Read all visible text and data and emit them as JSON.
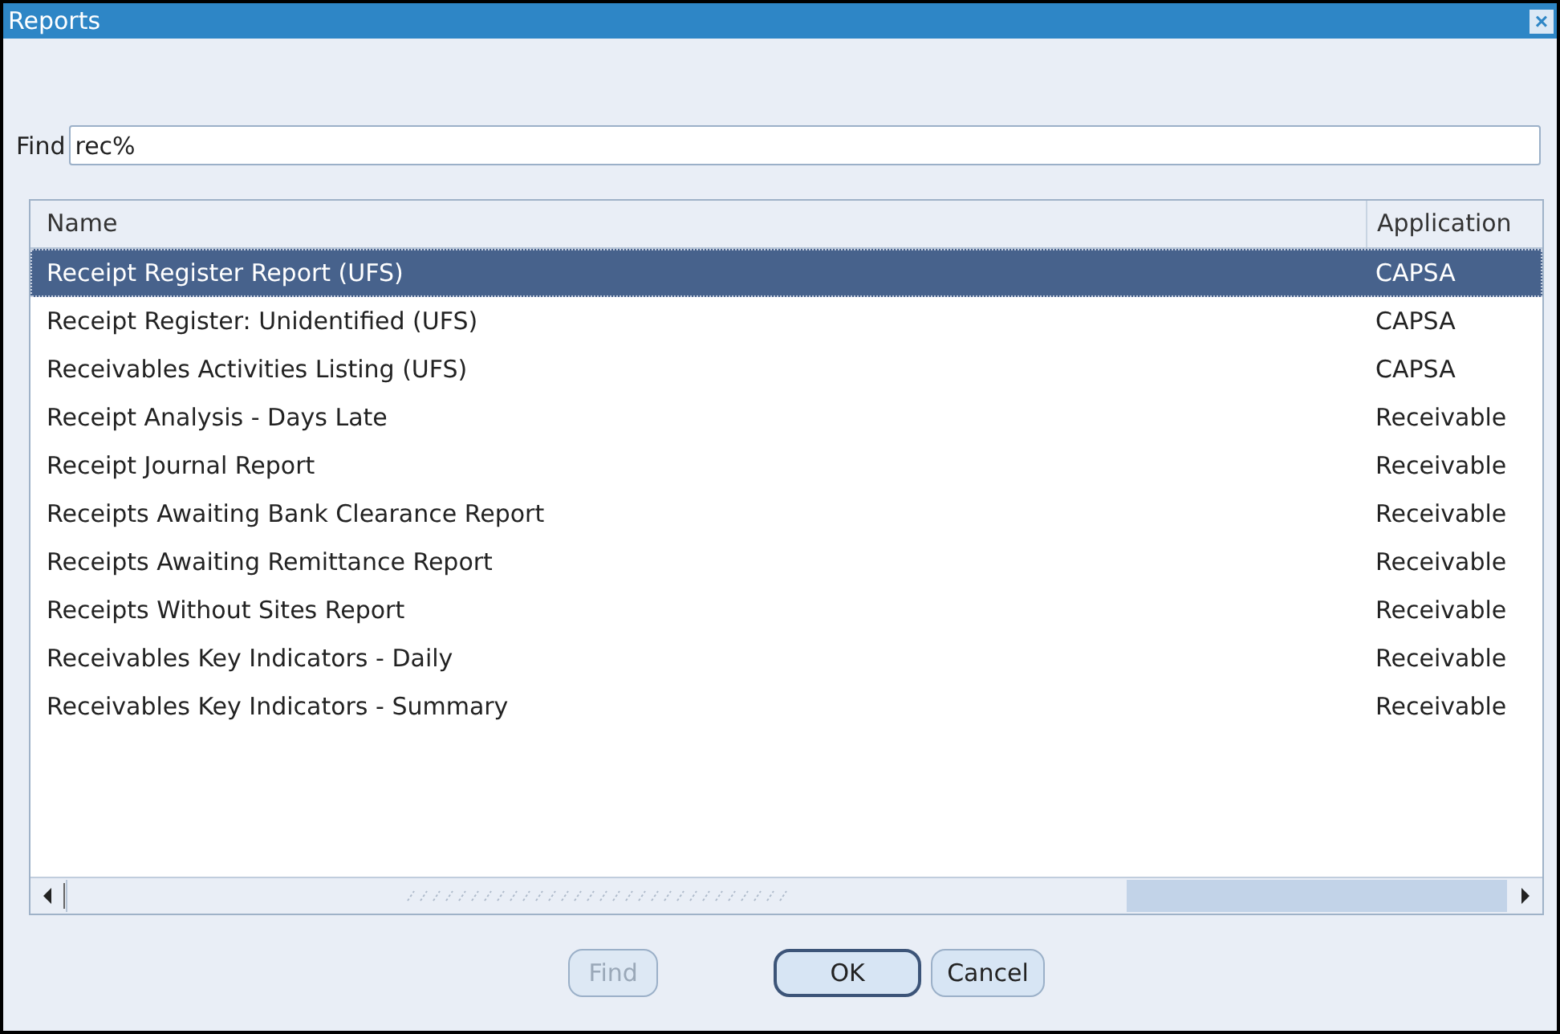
{
  "window": {
    "title": "Reports",
    "close_icon": "×"
  },
  "find": {
    "label": "Find",
    "value": "rec%"
  },
  "table": {
    "columns": [
      "Name",
      "Application"
    ],
    "rows": [
      {
        "name": "Receipt Register Report (UFS)",
        "application": "CAPSA",
        "selected": true
      },
      {
        "name": "Receipt Register: Unidentified (UFS)",
        "application": "CAPSA",
        "selected": false
      },
      {
        "name": "Receivables Activities Listing (UFS)",
        "application": "CAPSA",
        "selected": false
      },
      {
        "name": "Receipt Analysis - Days Late",
        "application": "Receivable",
        "selected": false
      },
      {
        "name": "Receipt Journal Report",
        "application": "Receivable",
        "selected": false
      },
      {
        "name": "Receipts Awaiting Bank Clearance Report",
        "application": "Receivable",
        "selected": false
      },
      {
        "name": "Receipts Awaiting Remittance Report",
        "application": "Receivable",
        "selected": false
      },
      {
        "name": "Receipts Without Sites Report",
        "application": "Receivable",
        "selected": false
      },
      {
        "name": "Receivables Key Indicators - Daily",
        "application": "Receivable",
        "selected": false
      },
      {
        "name": "Receivables Key Indicators - Summary",
        "application": "Receivable",
        "selected": false
      }
    ]
  },
  "buttons": [
    {
      "label": "Find",
      "disabled": true,
      "default": false
    },
    {
      "label": "OK",
      "disabled": false,
      "default": true
    },
    {
      "label": "Cancel",
      "disabled": false,
      "default": false
    }
  ]
}
